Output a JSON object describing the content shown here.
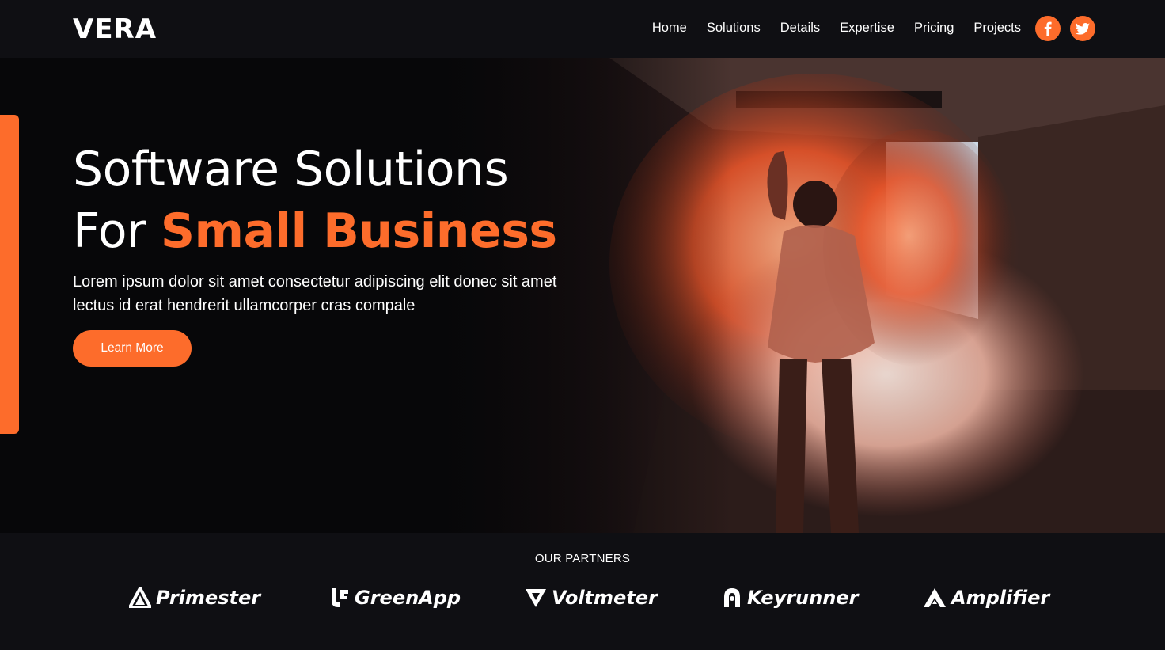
{
  "brand": {
    "logo_text": "VERA"
  },
  "nav": {
    "items": [
      "Home",
      "Solutions",
      "Details",
      "Expertise",
      "Pricing",
      "Projects"
    ],
    "social": [
      {
        "icon": "facebook-icon",
        "glyph": "f"
      },
      {
        "icon": "twitter-icon"
      }
    ]
  },
  "hero": {
    "headline_line1": "Software Solutions",
    "headline_line2_prefix": "For ",
    "headline_line2_accent": "Small Business",
    "lead": "Lorem ipsum dolor sit amet consectetur adipiscing elit donec sit amet lectus id erat hendrerit ullamcorper cras compale",
    "cta_label": "Learn More",
    "image_subject": "smoke-bomb-person-icon"
  },
  "partners": {
    "title": "OUR PARTNERS",
    "logos": [
      {
        "name": "Primester",
        "icon": "primester-logo-icon"
      },
      {
        "name": "GreenApp",
        "icon": "greenapp-logo-icon"
      },
      {
        "name": "Voltmeter",
        "icon": "voltmeter-logo-icon"
      },
      {
        "name": "Keyrunner",
        "icon": "keyrunner-logo-icon"
      },
      {
        "name": "Amplifier",
        "icon": "amplifier-logo-icon"
      }
    ]
  },
  "colors": {
    "accent": "#fd6c2b",
    "background": "#0a0a0d",
    "nav_background": "#0f0f13",
    "text": "#ffffff"
  }
}
